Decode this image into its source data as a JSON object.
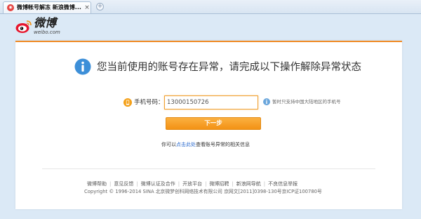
{
  "browser": {
    "tab_title": "微博帐号解冻 新浪微博...",
    "tab_close": "×",
    "new_tab": "+"
  },
  "logo": {
    "text": "微博",
    "sub": "weibo.com"
  },
  "main": {
    "headline": "您当前使用的账号存在异常，请完成以下操作解除异常状态",
    "phone_label": "手机号码：",
    "phone_value": "13000150726",
    "hint": "暂时只支持中国大陆地区的手机号",
    "next_button": "下一步",
    "help_prefix": "你可以",
    "help_link": "点击此处",
    "help_suffix": "查看账号异常的相关信息"
  },
  "footer": {
    "links": [
      "微博帮助",
      "意见反馈",
      "微博认证及合作",
      "开放平台",
      "微博招聘",
      "新浪网导航",
      "不良信息举报"
    ],
    "copyright": "Copyright © 1996-2014 SINA 北京微梦创科网络技术有限公司 京网文[2011]0398-130号京ICP证100780号"
  },
  "colors": {
    "accent": "#f39215",
    "link": "#2d6ccf",
    "background": "#dbe9f6"
  },
  "icons": {
    "info": "info-icon",
    "phone": "phone-icon",
    "hint": "info-small-icon",
    "logo": "weibo-eye-icon"
  }
}
